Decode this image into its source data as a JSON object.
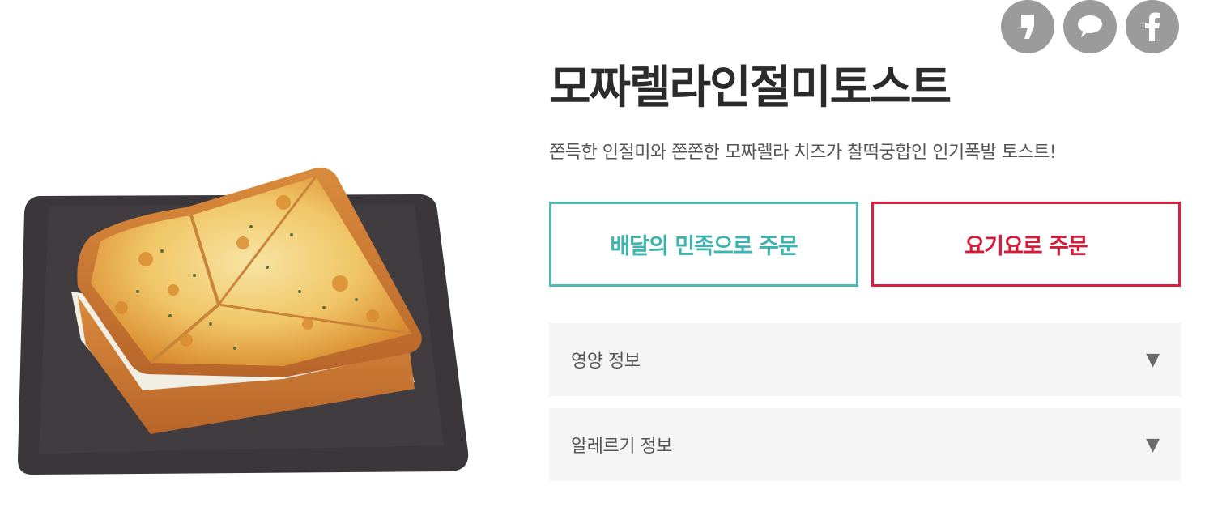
{
  "share": {
    "icons": [
      "kakaostory-icon",
      "kakaotalk-icon",
      "facebook-icon"
    ],
    "color": "#9b9b9b"
  },
  "product": {
    "title": "모짜렐라인절미토스트",
    "description": "쫀득한 인절미와 쫀쫀한 모짜렐라 치즈가 찰떡궁합인 인기폭발 토스트!"
  },
  "order": {
    "baemin_label": "배달의 민족으로 주문",
    "baemin_color": "#4fb8b5",
    "yogiyo_label": "요기요로 주문",
    "yogiyo_color": "#d8203f"
  },
  "info": {
    "nutrition_label": "영양 정보",
    "allergy_label": "알레르기 정보",
    "arrow": "▼"
  }
}
